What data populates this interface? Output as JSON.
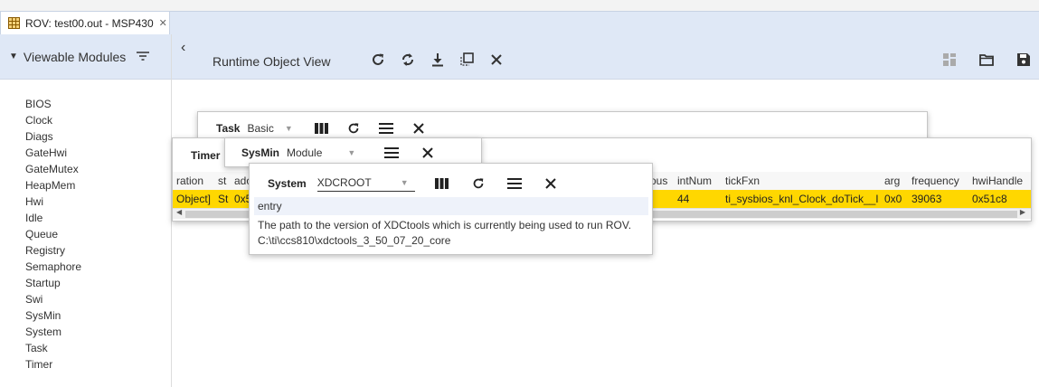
{
  "tab": {
    "title": "ROV: test00.out - MSP430",
    "close_glyph": "✕"
  },
  "left": {
    "header": "Viewable Modules",
    "modules": [
      "BIOS",
      "Clock",
      "Diags",
      "GateHwi",
      "GateMutex",
      "HeapMem",
      "Hwi",
      "Idle",
      "Queue",
      "Registry",
      "Semaphore",
      "Startup",
      "Swi",
      "SysMin",
      "System",
      "Task",
      "Timer"
    ]
  },
  "toolbar": {
    "back_glyph": "‹",
    "title": "Runtime Object View",
    "icons": [
      "refresh-icon",
      "continuous-refresh-icon",
      "download-icon",
      "snapshot-icon",
      "close-icon",
      "dashboard-icon",
      "folder-icon",
      "save-icon"
    ]
  },
  "task_panel": {
    "name": "Task",
    "view": "Basic"
  },
  "timer_panel": {
    "name": "Timer",
    "columns": [
      "ration",
      "st",
      "ado",
      "ous",
      "intNum",
      "tickFxn",
      "arg",
      "frequency",
      "hwiHandle"
    ],
    "row": [
      "Object]",
      "St",
      "0x5",
      "",
      "44",
      "ti_sysbios_knl_Clock_doTick__I",
      "0x0",
      "39063",
      "0x51c8"
    ]
  },
  "sysmin_panel": {
    "name": "SysMin",
    "view": "Module"
  },
  "system_panel": {
    "name": "System",
    "view": "XDCROOT",
    "header": "entry",
    "line1": "The path to the version of XDCtools which is currently being used to run ROV.",
    "line2": "C:\\ti\\ccs810\\xdctools_3_50_07_20_core"
  },
  "colors": {
    "accent": "#dfe8f6",
    "row_highlight": "#ffd700"
  }
}
